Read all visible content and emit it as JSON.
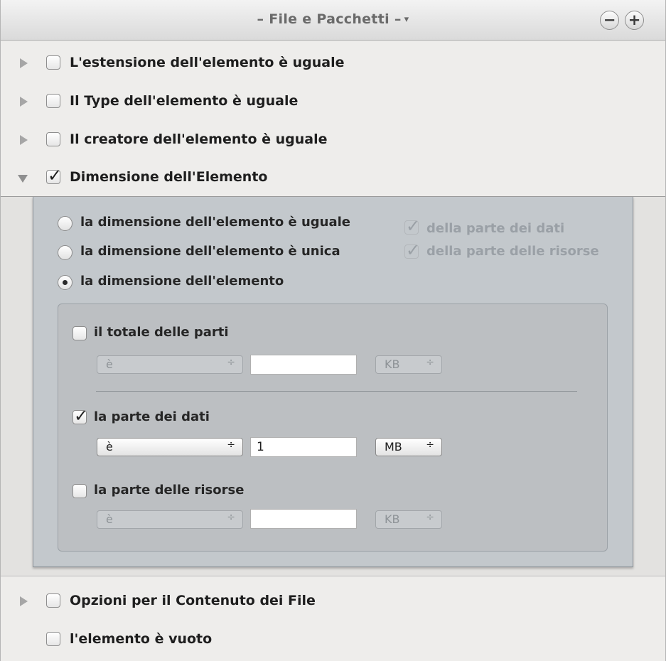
{
  "header": {
    "title": "– File e Pacchetti –",
    "caret": "▾",
    "minus": "−",
    "plus": "+"
  },
  "rows": [
    {
      "label": "L'estensione dell'elemento è uguale",
      "checked": false
    },
    {
      "label": "Il Type dell'elemento è uguale",
      "checked": false
    },
    {
      "label": "Il creatore dell'elemento è uguale",
      "checked": false
    },
    {
      "label": "Dimensione dell'Elemento",
      "checked": true
    },
    {
      "label": "Opzioni per il Contenuto dei File",
      "checked": false
    },
    {
      "label": "l'elemento è vuoto",
      "checked": false
    }
  ],
  "size_options": {
    "radios": [
      {
        "label": "la dimensione dell'elemento è uguale",
        "selected": false
      },
      {
        "label": "la dimensione dell'elemento è unica",
        "selected": false
      },
      {
        "label": "la dimensione dell'elemento",
        "selected": true
      }
    ],
    "forks": [
      {
        "label": "della parte dei dati",
        "checked": true
      },
      {
        "label": "della parte delle risorse",
        "checked": true
      }
    ]
  },
  "parts": [
    {
      "label": "il totale delle parti",
      "checked": false,
      "operator": "è",
      "value": "",
      "unit": "KB"
    },
    {
      "label": "la parte dei dati",
      "checked": true,
      "operator": "è",
      "value": "1",
      "unit": "MB"
    },
    {
      "label": "la parte delle risorse",
      "checked": false,
      "operator": "è",
      "value": "",
      "unit": "KB"
    }
  ],
  "select_arrows": "÷"
}
